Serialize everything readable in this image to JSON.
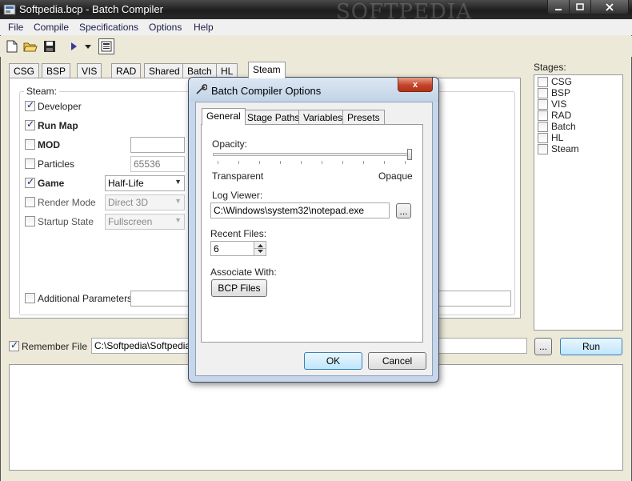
{
  "window": {
    "title": "Softpedia.bcp - Batch Compiler",
    "watermark": "SOFTPEDIA"
  },
  "menu": [
    "File",
    "Compile",
    "Specifications",
    "Options",
    "Help"
  ],
  "toolbar": {
    "icons": [
      "new-file-icon",
      "open-folder-icon",
      "save-icon",
      "run-icon",
      "dropdown-icon",
      "options-icon"
    ]
  },
  "main_tabs": [
    "CSG",
    "BSP",
    "VIS",
    "RAD",
    "Shared",
    "Batch",
    "HL",
    "Steam"
  ],
  "active_main_tab": "Steam",
  "steam": {
    "group_label": "Steam:",
    "developer": {
      "label": "Developer",
      "checked": true
    },
    "run_map": {
      "label": "Run Map",
      "checked": true
    },
    "mod": {
      "label": "MOD",
      "checked": false,
      "value": ""
    },
    "particles": {
      "label": "Particles",
      "checked": false,
      "value": "65536"
    },
    "game": {
      "label": "Game",
      "checked": true,
      "value": "Half-Life"
    },
    "render_mode": {
      "label": "Render Mode",
      "checked": false,
      "value": "Direct 3D"
    },
    "startup_state": {
      "label": "Startup State",
      "checked": false,
      "value": "Fullscreen"
    },
    "additional_params": {
      "label": "Additional Parameters",
      "checked": false,
      "value": ""
    }
  },
  "stages": {
    "label": "Stages:",
    "items": [
      "CSG",
      "BSP",
      "VIS",
      "RAD",
      "Batch",
      "HL",
      "Steam"
    ]
  },
  "remember_file": {
    "label": "Remember File",
    "checked": true,
    "path": "C:\\Softpedia\\Softpedia.b",
    "browse_label": "...",
    "run_label": "Run"
  },
  "dialog": {
    "title": "Batch Compiler Options",
    "close_label": "x",
    "tabs": [
      "General",
      "Stage Paths",
      "Variables",
      "Presets"
    ],
    "active_tab": "General",
    "opacity": {
      "label": "Opacity:",
      "min_label": "Transparent",
      "max_label": "Opaque",
      "value_fraction": 1.0
    },
    "log_viewer": {
      "label": "Log Viewer:",
      "value": "C:\\Windows\\system32\\notepad.exe",
      "browse_label": "..."
    },
    "recent_files": {
      "label": "Recent Files:",
      "value": "6"
    },
    "associate": {
      "label": "Associate With:",
      "button_label": "BCP Files"
    },
    "ok_label": "OK",
    "cancel_label": "Cancel"
  }
}
